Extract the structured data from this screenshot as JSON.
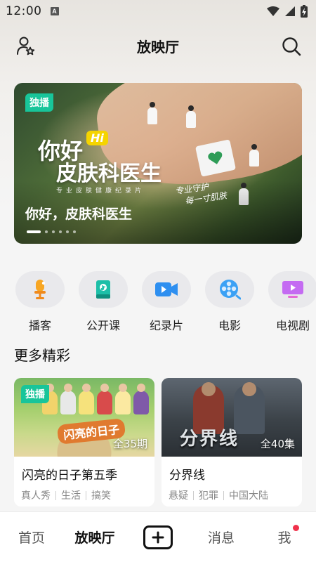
{
  "status_bar": {
    "time": "12:00",
    "notification_letter": "A"
  },
  "header": {
    "title": "放映厅"
  },
  "banner": {
    "badge": "独播",
    "logo_line1": "你好",
    "logo_hi": "Hi",
    "logo_line2": "皮肤科医生",
    "logo_sub": "专业皮肤健康纪录片",
    "handwriting_line1": "专业守护",
    "handwriting_line2": "每一寸肌肤",
    "caption": "你好，皮肤科医生",
    "page_count": 6,
    "active_page": 1
  },
  "categories": [
    {
      "label": "播客",
      "icon": "microphone-icon"
    },
    {
      "label": "公开课",
      "icon": "book-icon"
    },
    {
      "label": "纪录片",
      "icon": "video-camera-icon"
    },
    {
      "label": "电影",
      "icon": "film-reel-icon"
    },
    {
      "label": "电视剧",
      "icon": "tv-icon"
    }
  ],
  "section": {
    "title": "更多精彩"
  },
  "cards": [
    {
      "badge": "独播",
      "episode_count": "全35期",
      "thumb_logo": "闪亮的日子",
      "title": "闪亮的日子第五季",
      "tags": [
        "真人秀",
        "生活",
        "搞笑"
      ]
    },
    {
      "episode_count": "全40集",
      "thumb_logo": "分界线",
      "title": "分界线",
      "tags": [
        "悬疑",
        "犯罪",
        "中国大陆"
      ]
    }
  ],
  "bottom_nav": {
    "home": "首页",
    "theater": "放映厅",
    "messages": "消息",
    "me": "我"
  },
  "colors": {
    "badge_green": "#18c59a",
    "notification_red": "#f0314b"
  }
}
